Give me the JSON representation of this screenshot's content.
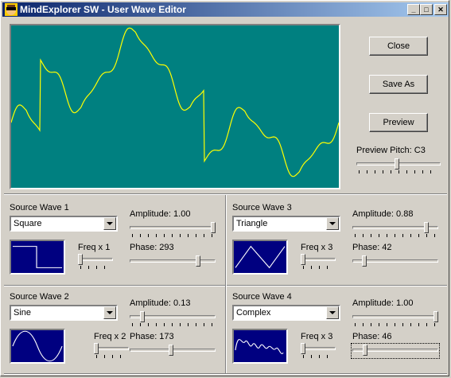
{
  "window": {
    "title": "MindExplorer SW - User Wave Editor",
    "minimize": "_",
    "maximize": "□",
    "close": "✕"
  },
  "buttons": {
    "close": "Close",
    "save_as": "Save As",
    "preview": "Preview"
  },
  "preview_pitch": {
    "label": "Preview Pitch: C3",
    "level": 0.48
  },
  "sources": [
    {
      "title": "Source Wave 1",
      "wave": "Square",
      "amplitude_label": "Amplitude: 1.00",
      "amplitude": 1.0,
      "freq_label": "Freq x 1",
      "freq_level": 0.0,
      "phase_label": "Phase: 293",
      "phase_level": 0.81
    },
    {
      "title": "Source Wave 2",
      "wave": "Sine",
      "amplitude_label": "Amplitude: 0.13",
      "amplitude": 0.13,
      "freq_label": "Freq x 2",
      "freq_level": 0.0,
      "phase_label": "Phase: 173",
      "phase_level": 0.48
    },
    {
      "title": "Source Wave 3",
      "wave": "Triangle",
      "amplitude_label": "Amplitude: 0.88",
      "amplitude": 0.88,
      "freq_label": "Freq x 3",
      "freq_level": 0.0,
      "phase_label": "Phase: 42",
      "phase_level": 0.12
    },
    {
      "title": "Source Wave 4",
      "wave": "Complex",
      "amplitude_label": "Amplitude: 1.00",
      "amplitude": 1.0,
      "freq_label": "Freq x 3",
      "freq_level": 0.0,
      "phase_label": "Phase: 46",
      "phase_level": 0.13
    }
  ],
  "colors": {
    "scope_bg": "#008080",
    "scope_line": "#ffff00",
    "preview_bg": "#000080",
    "preview_line": "#ffffff"
  }
}
